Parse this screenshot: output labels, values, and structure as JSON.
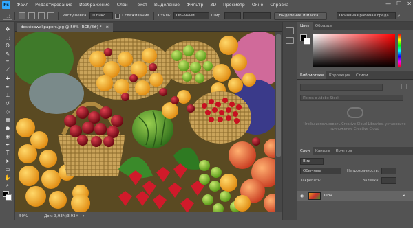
{
  "app": {
    "logo": "Ps"
  },
  "menu": [
    "Файл",
    "Редактирование",
    "Изображение",
    "Слои",
    "Текст",
    "Выделение",
    "Фильтр",
    "3D",
    "Просмотр",
    "Окно",
    "Справка"
  ],
  "window_controls": [
    "—",
    "☐",
    "✕"
  ],
  "options": {
    "feather_label": "Растушевка:",
    "feather_value": "0 пикс.",
    "smooth_label": "Сглаживание",
    "style_label": "Стиль:",
    "style_value": "Обычный",
    "width_label": "Шир.:",
    "select_mask_button": "Выделение и маска...",
    "workspace_value": "Основная рабочая среда"
  },
  "document": {
    "tab_title": "desktopwallpapers.jpg @ 50% (RGB/8#) *",
    "tab_close": "×"
  },
  "status": {
    "zoom": "50%",
    "doc_info": "Док: 3,93M/3,93M"
  },
  "panels": {
    "color_tabs": [
      "Цвет",
      "Образцы"
    ],
    "library_tabs": [
      "Библиотеки",
      "Коррекция",
      "Стили"
    ],
    "library_search_placeholder": "Поиск в Adobe Stock",
    "library_message": "Чтобы использовать Creative Cloud Libraries, установите приложение Creative Cloud",
    "layers_tabs": [
      "Слои",
      "Каналы",
      "Контуры"
    ],
    "layers_kind": "Вид",
    "blend_mode": "Обычные",
    "opacity_label": "Непрозрачность:",
    "lock_label": "Закрепить:",
    "fill_label": "Заливка:",
    "layer_name": "Фон"
  },
  "colors": {
    "accent": "#31a8ff",
    "panel_bg": "#535353",
    "layer_selected": "#656565"
  }
}
